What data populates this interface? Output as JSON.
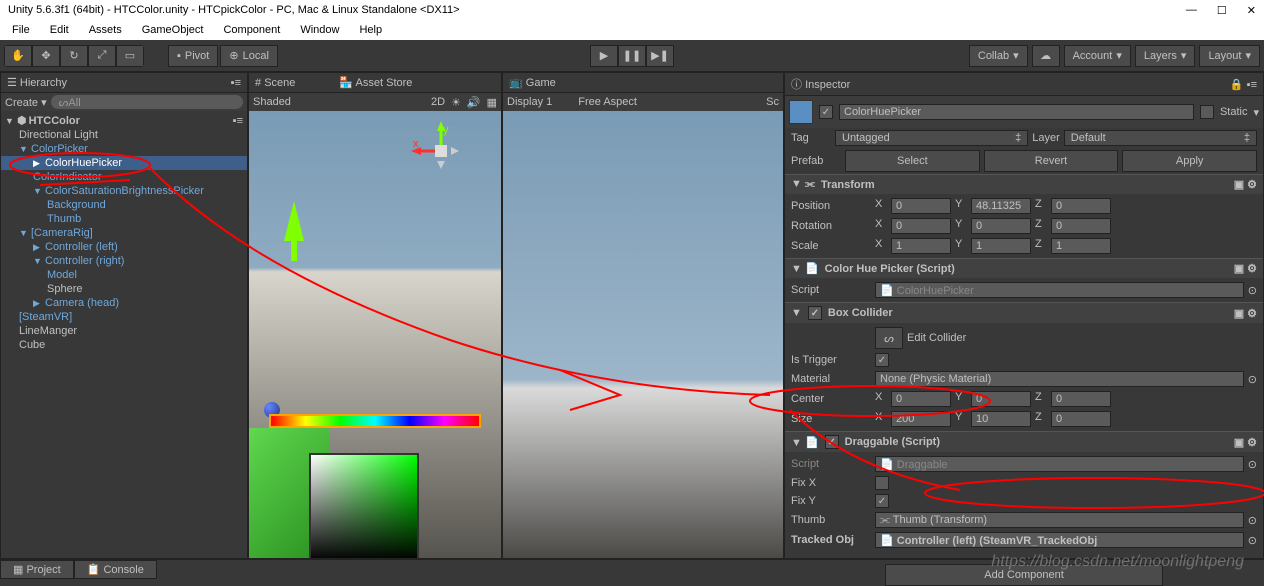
{
  "window": {
    "title": "Unity 5.6.3f1 (64bit) - HTCColor.unity - HTCpickColor - PC, Mac & Linux Standalone <DX11>"
  },
  "menu": [
    "File",
    "Edit",
    "Assets",
    "GameObject",
    "Component",
    "Window",
    "Help"
  ],
  "toolbar": {
    "pivot": "Pivot",
    "local": "Local",
    "collab": "Collab",
    "account": "Account",
    "layers": "Layers",
    "layout": "Layout"
  },
  "hierarchy": {
    "title": "Hierarchy",
    "create": "Create",
    "search_placeholder": "All",
    "scene": "HTCColor",
    "items": [
      {
        "label": "Directional Light",
        "indent": 1,
        "blue": false
      },
      {
        "label": "ColorPicker",
        "indent": 1,
        "blue": true,
        "arrow": "▼"
      },
      {
        "label": "ColorHuePicker",
        "indent": 2,
        "blue": true,
        "sel": true,
        "arrow": "▶"
      },
      {
        "label": "ColorIndicator",
        "indent": 2,
        "blue": true
      },
      {
        "label": "ColorSaturationBrightnessPicker",
        "indent": 2,
        "blue": true,
        "arrow": "▼"
      },
      {
        "label": "Background",
        "indent": 3,
        "blue": true
      },
      {
        "label": "Thumb",
        "indent": 3,
        "blue": true
      },
      {
        "label": "[CameraRig]",
        "indent": 1,
        "blue": true,
        "arrow": "▼"
      },
      {
        "label": "Controller (left)",
        "indent": 2,
        "blue": true,
        "arrow": "▶"
      },
      {
        "label": "Controller (right)",
        "indent": 2,
        "blue": true,
        "arrow": "▼"
      },
      {
        "label": "Model",
        "indent": 3,
        "blue": true
      },
      {
        "label": "Sphere",
        "indent": 3,
        "blue": false
      },
      {
        "label": "Camera (head)",
        "indent": 2,
        "blue": true,
        "arrow": "▶"
      },
      {
        "label": "[SteamVR]",
        "indent": 1,
        "blue": true
      },
      {
        "label": "LineManger",
        "indent": 1,
        "blue": false
      },
      {
        "label": "Cube",
        "indent": 1,
        "blue": false
      }
    ]
  },
  "scene": {
    "tab1": "Scene",
    "tab2": "Asset Store",
    "shaded": "Shaded",
    "mode2d": "2D"
  },
  "game": {
    "tab": "Game",
    "display": "Display 1",
    "aspect": "Free Aspect",
    "scale": "Sc"
  },
  "inspector": {
    "title": "Inspector",
    "name": "ColorHuePicker",
    "static": "Static",
    "tag_label": "Tag",
    "tag_value": "Untagged",
    "layer_label": "Layer",
    "layer_value": "Default",
    "prefab_label": "Prefab",
    "prefab_select": "Select",
    "prefab_revert": "Revert",
    "prefab_apply": "Apply",
    "transform": {
      "title": "Transform",
      "position": "Position",
      "rotation": "Rotation",
      "scale": "Scale",
      "pos": {
        "x": "0",
        "y": "48.11325",
        "z": "0"
      },
      "rot": {
        "x": "0",
        "y": "0",
        "z": "0"
      },
      "scl": {
        "x": "1",
        "y": "1",
        "z": "1"
      }
    },
    "huepicker": {
      "title": "Color Hue Picker (Script)",
      "script_label": "Script",
      "script_value": "ColorHuePicker"
    },
    "boxcollider": {
      "title": "Box Collider",
      "edit": "Edit Collider",
      "trigger": "Is Trigger",
      "material": "Material",
      "material_value": "None (Physic Material)",
      "center": "Center",
      "size": "Size",
      "center_v": {
        "x": "0",
        "y": "0",
        "z": "0"
      },
      "size_v": {
        "x": "200",
        "y": "10",
        "z": "0"
      }
    },
    "draggable": {
      "title": "Draggable (Script)",
      "script_label": "Script",
      "script_value": "Draggable",
      "fixx": "Fix X",
      "fixy": "Fix Y",
      "thumb": "Thumb",
      "thumb_value": "Thumb (Transform)",
      "tracked": "Tracked Obj",
      "tracked_value": "Controller (left) (SteamVR_TrackedObj"
    },
    "add_component": "Add Component"
  },
  "bottom": {
    "project": "Project",
    "console": "Console"
  },
  "watermark": "https://blog.csdn.net/moonlightpeng"
}
